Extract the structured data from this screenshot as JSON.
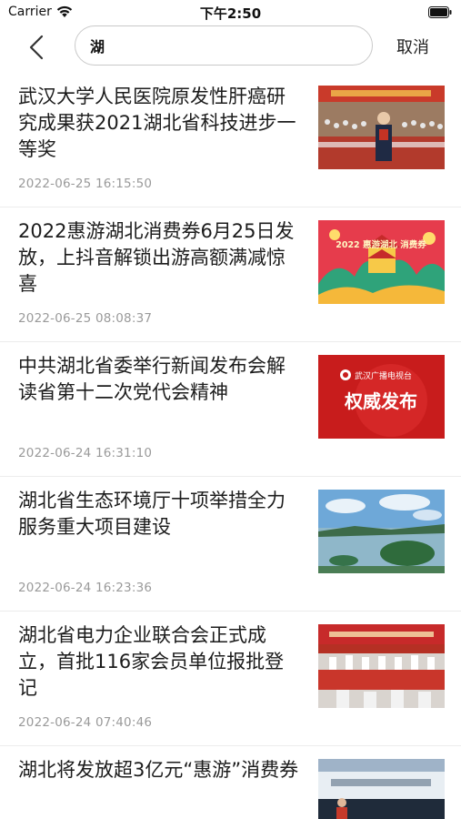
{
  "status_bar": {
    "carrier": "Carrier",
    "time": "下午2:50"
  },
  "search": {
    "query": "湖",
    "cancel_label": "取消"
  },
  "news": [
    {
      "title": "武汉大学人民医院原发性肝癌研究成果获2021湖北省科技进步一等奖",
      "date": "2022-06-25 16:15:50",
      "thumb": "award-ceremony"
    },
    {
      "title": "2022惠游湖北消费券6月25日发放，上抖音解锁出游高额满减惊喜",
      "date": "2022-06-25 08:08:37",
      "thumb": "tourism-poster",
      "thumb_text": "2022 惠游湖北 消费券"
    },
    {
      "title": "中共湖北省委举行新闻发布会解读省第十二次党代会精神",
      "date": "2022-06-24 16:31:10",
      "thumb": "news-brand-card",
      "thumb_logo": "武汉广播电视台",
      "thumb_text": "权威发布"
    },
    {
      "title": "湖北省生态环境厅十项举措全力服务重大项目建设",
      "date": "2022-06-24 16:23:36",
      "thumb": "lake-landscape"
    },
    {
      "title": "湖北省电力企业联合会正式成立，首批116家会员单位报批登记",
      "date": "2022-06-24 07:40:46",
      "thumb": "conference-hall"
    },
    {
      "title": "湖北将发放超3亿元“惠游”消费券",
      "date": "",
      "thumb": "station-banner"
    }
  ],
  "colors": {
    "text_primary": "#1c1c1c",
    "text_secondary": "#9a9a9a",
    "divider": "#ececec",
    "brand_red": "#d01e1e"
  }
}
